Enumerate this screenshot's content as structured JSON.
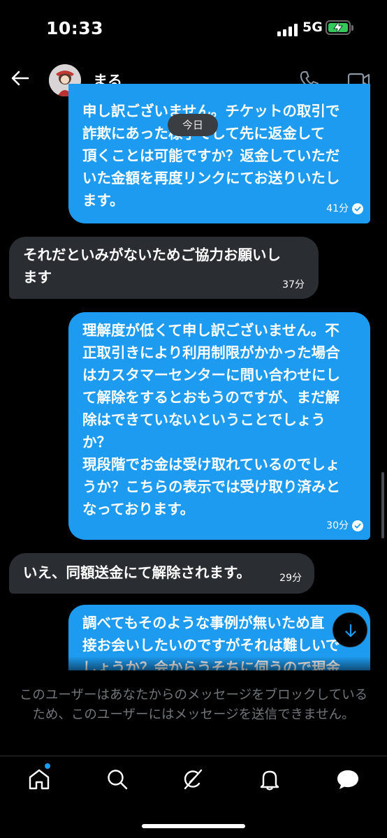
{
  "status_bar": {
    "time": "10:33",
    "network": "5G"
  },
  "header": {
    "contact_name": "まる"
  },
  "date_pill": "今日",
  "messages": [
    {
      "direction": "sent",
      "text": "申し訳ございません。チケットの取引で\n詐欺にあった様子でして先に返金して\n頂くことは可能ですか？返金していただ\nいた金額を再度リンクにてお送りいたし\nます。",
      "time": "41分",
      "read": true
    },
    {
      "direction": "received",
      "text": "それだといみがないためご協力お願いし\nます",
      "time": "37分"
    },
    {
      "direction": "sent",
      "text": "理解度が低くて申し訳ございません。不\n正取引きにより利用制限がかかった場合\nはカスタマーセンターに問い合わせにし\nて解除をするとおもうのですが、まだ解\n除はできていないということでしょう\nか？\n現段階でお金は受け取れているのでしょ\nうか？こちらの表示では受け取り済みと\nなっております。",
      "time": "30分",
      "read": true
    },
    {
      "direction": "received",
      "text": "いえ、同額送金にて解除されます。",
      "time": "29分"
    },
    {
      "direction": "sent",
      "text": "調べてもそのような事例が無いため直\n接お会いしたいのですがそれは難しいで\nしょうか？会からうそちに伺うので現金",
      "time": "",
      "read": false
    }
  ],
  "blocked_notice": "このユーザーはあなたからのメッセージをブロックしているため、このユーザーにはメッセージを送信できません。",
  "icons": {
    "back": "arrow-left-icon",
    "phone": "phone-icon",
    "video": "video-camera-icon",
    "scroll_down": "arrow-down-icon",
    "home": "home-icon",
    "search": "search-icon",
    "grok": "grok-icon",
    "notifications": "bell-icon",
    "messages": "message-bubble-icon"
  },
  "colors": {
    "accent": "#1d9bf0",
    "received_bubble": "#2a2d32",
    "background": "#000000",
    "battery": "#34c759"
  }
}
